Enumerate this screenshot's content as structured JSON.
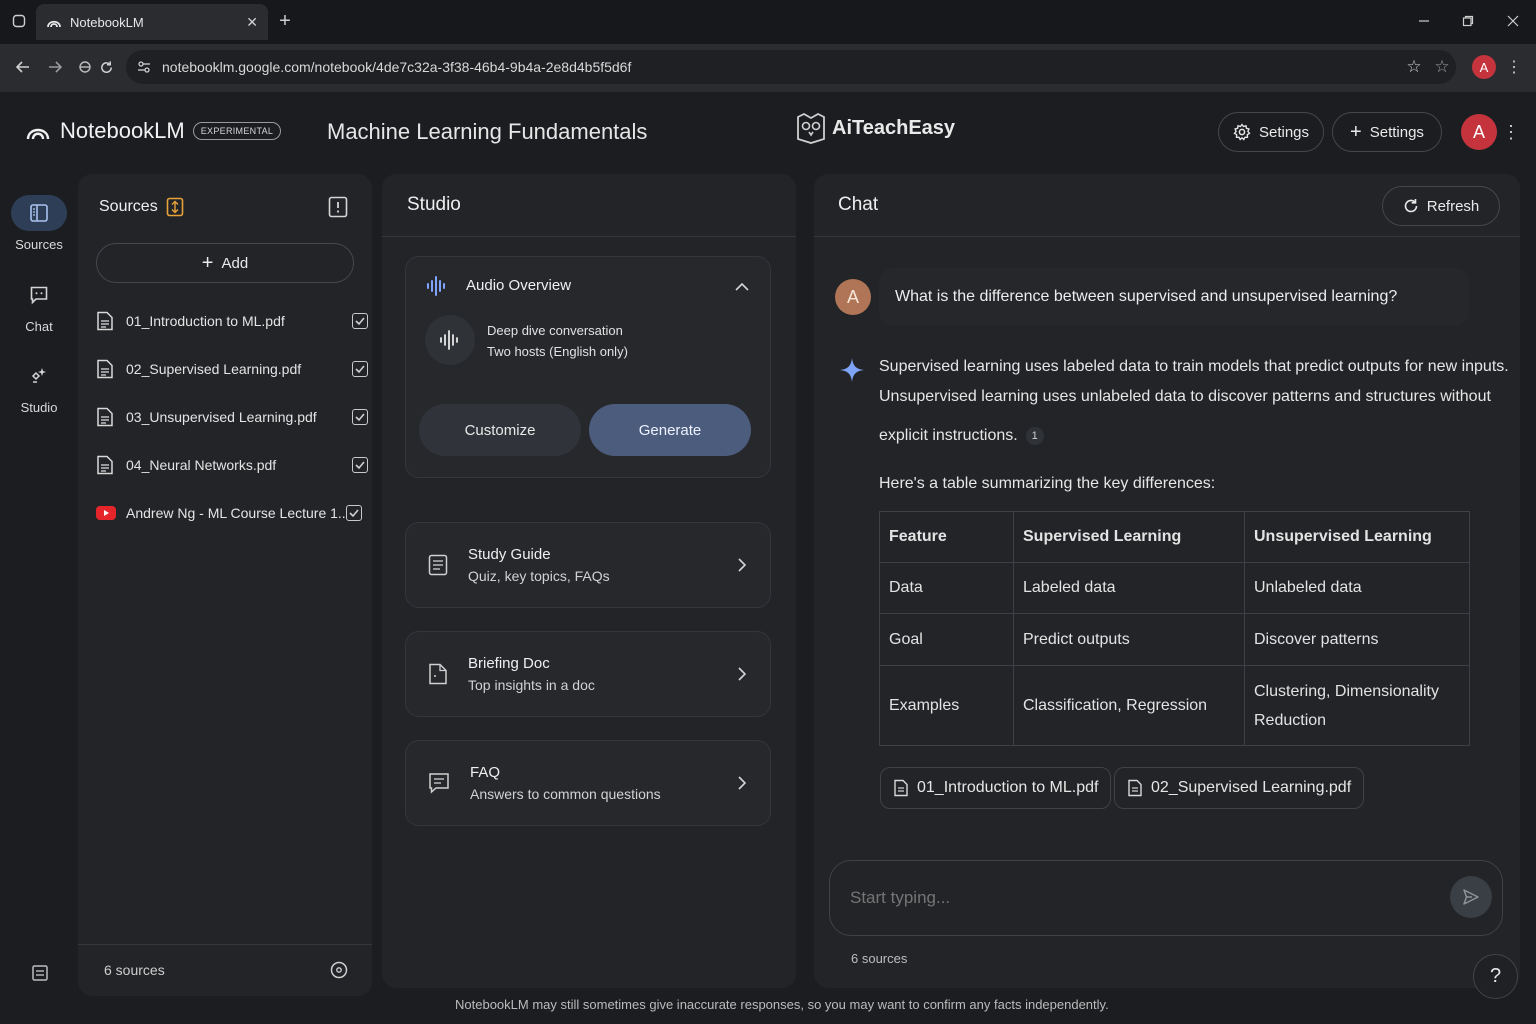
{
  "browser": {
    "tab_title": "NotebookLM",
    "url": "notebooklm.google.com/notebook/4de7c32a-3f38-46b4-9b4a-2e8d4b5f5d6f",
    "profile_initial": "A"
  },
  "header": {
    "app_name": "NotebookLM",
    "badge": "EXPERIMENTAL",
    "notebook_title": "Machine Learning Fundamentals",
    "brand": "AiTeachEasy",
    "btn_settings_1": "Setings",
    "btn_settings_2": "Settings",
    "avatar_initial": "A"
  },
  "rail": {
    "sources": "Sources",
    "chat": "Chat",
    "studio": "Studio"
  },
  "sources": {
    "title": "Sources",
    "add_label": "Add",
    "items": [
      {
        "name": "01_Introduction to ML.pdf",
        "type": "pdf"
      },
      {
        "name": "02_Supervised Learning.pdf",
        "type": "pdf"
      },
      {
        "name": "03_Unsupervised Learning.pdf",
        "type": "pdf"
      },
      {
        "name": "04_Neural Networks.pdf",
        "type": "pdf"
      },
      {
        "name": "Andrew Ng - ML Course Lecture 1...",
        "type": "youtube"
      }
    ],
    "footer_count": "6 sources"
  },
  "studio": {
    "title": "Studio",
    "audio": {
      "title": "Audio Overview",
      "line1": "Deep dive conversation",
      "line2": "Two hosts (English only)",
      "customize": "Customize",
      "generate": "Generate"
    },
    "tools": [
      {
        "title": "Study Guide",
        "subtitle": "Quiz, key topics, FAQs",
        "icon": "study-guide-icon"
      },
      {
        "title": "Briefing Doc",
        "subtitle": "Top insights in a doc",
        "icon": "briefing-doc-icon"
      },
      {
        "title": "FAQ",
        "subtitle": "Answers to common questions",
        "icon": "faq-icon"
      }
    ]
  },
  "chat": {
    "title": "Chat",
    "refresh": "Refresh",
    "user_initial": "A",
    "question": "What is the difference between supervised and unsupervised learning?",
    "answer_line1": "Supervised learning uses labeled data to train models that predict outputs for new inputs.",
    "answer_line2": "Unsupervised learning uses unlabeled data to discover patterns and structures without",
    "answer_line3": "explicit instructions.",
    "citation": "1",
    "table_intro": "Here's a table summarizing the key differences:",
    "table": {
      "headers": [
        "Feature",
        "Supervised Learning",
        "Unsupervised Learning"
      ],
      "rows": [
        [
          "Data",
          "Labeled data",
          "Unlabeled data"
        ],
        [
          "Goal",
          "Predict outputs",
          "Discover patterns"
        ],
        [
          "Examples",
          "Classification, Regression",
          "Clustering, Dimensionality Reduction"
        ]
      ]
    },
    "source_chips": [
      "01_Introduction to ML.pdf",
      "02_Supervised Learning.pdf"
    ],
    "input_placeholder": "Start typing...",
    "footer_count": "6 sources"
  },
  "disclaimer": "NotebookLM may still sometimes give inaccurate responses, so you may want to confirm any facts independently.",
  "help_label": "?",
  "colors": {
    "background": "#1b1d20",
    "panel": "#222427",
    "accent_blue": "#4b5c7c",
    "avatar_red": "#c5343d",
    "user_avatar": "#b07556",
    "youtube_red": "#e5252a",
    "badge_orange": "#e8a23a"
  }
}
